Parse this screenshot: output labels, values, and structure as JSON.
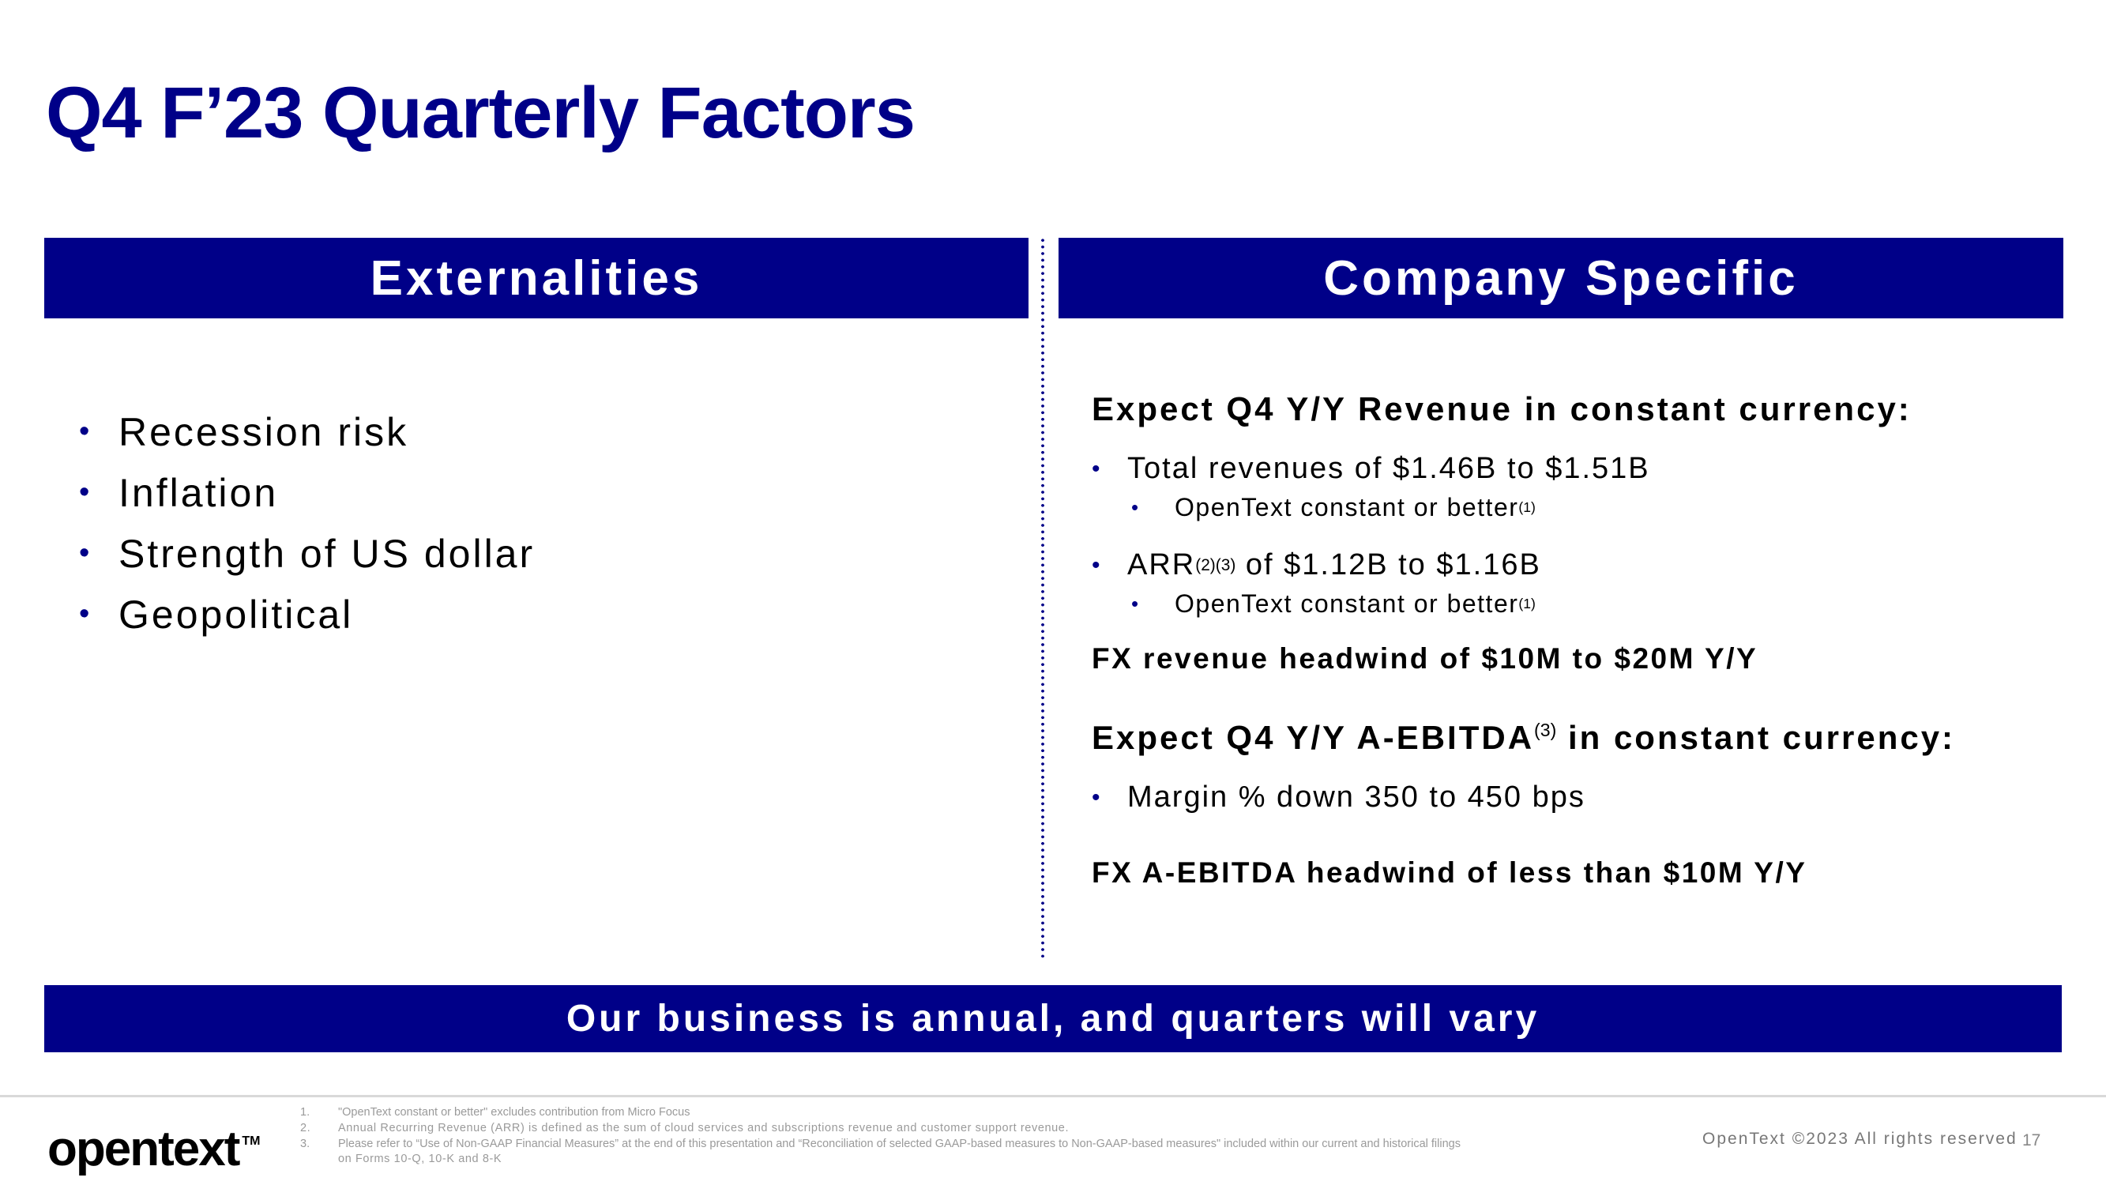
{
  "title": "Q4 F’23 Quarterly Factors",
  "externalities": {
    "header": "Externalities",
    "items": [
      "Recession risk",
      "Inflation",
      "Strength of US dollar",
      "Geopolitical"
    ]
  },
  "company_specific": {
    "header": "Company Specific",
    "revenue_heading": "Expect Q4 Y/Y Revenue in constant currency:",
    "total_revenue": "Total revenues of $1.46B to $1.51B",
    "total_revenue_sub": "OpenText constant or better",
    "total_revenue_sub_note": "(1)",
    "arr_label": "ARR",
    "arr_notes": "(2)(3)",
    "arr_value": " of $1.12B to $1.16B",
    "arr_sub": "OpenText constant or better",
    "arr_sub_note": "(1)",
    "fx_revenue": "FX revenue headwind of $10M to $20M Y/Y",
    "ebitda_heading_pre": "Expect Q4 Y/Y A-EBITDA",
    "ebitda_heading_note": "(3)",
    "ebitda_heading_post": " in constant currency:",
    "margin": "Margin % down 350 to 450 bps",
    "fx_ebitda": "FX A-EBITDA headwind of less than $10M Y/Y"
  },
  "banner": "Our business is annual, and quarters will vary",
  "footer": {
    "logo": "opentext",
    "logo_tm": "TM",
    "footnotes": [
      {
        "num": "1.",
        "text": "\"OpenText constant or better\" excludes contribution from Micro Focus"
      },
      {
        "num": "2.",
        "text": "Annual Recurring Revenue (ARR) is defined as the sum of cloud services and subscriptions revenue and customer support revenue."
      },
      {
        "num": "3.",
        "text": "Please refer to “Use of Non-GAAP Financial Measures” at the end of this presentation and “Reconciliation of selected GAAP-based measures to Non-GAAP-based measures\" included within our current and historical filings"
      },
      {
        "num": "",
        "text": "on Forms 10-Q, 10-K and 8-K"
      }
    ],
    "copyright": "OpenText ©2023 All rights reserved",
    "page_number": "17"
  },
  "colors": {
    "brand_navy": "#000088",
    "footer_gray": "#9a9a9a"
  },
  "icons": {
    "bullet": "•"
  }
}
